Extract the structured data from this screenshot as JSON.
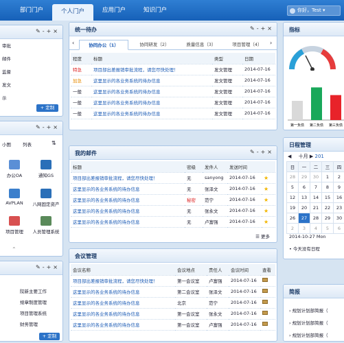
{
  "nav": {
    "tabs": [
      "部门门户",
      "个人门户",
      "应用门户",
      "知识门户"
    ],
    "active": 1,
    "greeting": "你好，Test"
  },
  "left_top": {
    "items": [
      "审批",
      "邮件",
      "监督",
      "发文",
      "示"
    ],
    "custom_button": "+ 定制"
  },
  "left_mid": {
    "tabs": [
      "小图",
      "列表"
    ],
    "apps": [
      "办公OA",
      "通知GS",
      "AVPLAN",
      "八网固定资产",
      "项目管理",
      "人员管理系统"
    ]
  },
  "left_bottom": {
    "items": [
      "院新主要工作",
      "规章制度管理",
      "项目管理系统",
      "财务管理"
    ],
    "custom_button": "+ 定制"
  },
  "todo": {
    "title": "统一待办",
    "tabs": [
      "协同办公（1）",
      "协同研发（2）",
      "质量信息（3）",
      "项目管理（4）"
    ],
    "headers": [
      "程度",
      "标题",
      "类型",
      "日期"
    ],
    "rows": [
      {
        "level": "特急",
        "title": "项目部出差报销审批流程，请您尽快处理！",
        "type": "发文管理",
        "date": "2014-07-16"
      },
      {
        "level": "加急",
        "title": "这里显示的各业务系统的待办信息",
        "type": "发文管理",
        "date": "2014-07-16"
      },
      {
        "level": "一般",
        "title": "这里显示的各业务系统的待办信息",
        "type": "发文管理",
        "date": "2014-07-16"
      },
      {
        "level": "一般",
        "title": "这里显示的各业务系统的待办信息",
        "type": "发文管理",
        "date": "2014-07-16"
      },
      {
        "level": "一般",
        "title": "这里显示的各业务系统的待办信息",
        "type": "发文管理",
        "date": "2014-07-16"
      }
    ]
  },
  "mail": {
    "title": "我的邮件",
    "headers": [
      "标题",
      "密级",
      "发件人",
      "发送时间"
    ],
    "rows": [
      {
        "title": "项目部出差报销审批流程，请您尽快处理！",
        "secret": "无",
        "sender": "sanyong",
        "date": "2014-07-16"
      },
      {
        "title": "这里显示的各业务系统的待办信息",
        "secret": "无",
        "sender": "张泽文",
        "date": "2014-07-16"
      },
      {
        "title": "这里显示的各业务系统的待办信息",
        "secret": "秘密",
        "sender": "范宁",
        "date": "2014-07-16"
      },
      {
        "title": "这里显示的各业务系统的待办信息",
        "secret": "无",
        "sender": "张永文",
        "date": "2014-07-16"
      },
      {
        "title": "这里显示的各业务系统的待办信息",
        "secret": "无",
        "sender": "卢富强",
        "date": "2014-07-16"
      }
    ],
    "more": "更多"
  },
  "meeting": {
    "title": "会议管理",
    "headers": [
      "会议名称",
      "会议地点",
      "责任人",
      "会议时间",
      "查看"
    ],
    "rows": [
      {
        "name": "项目部出差报销审批流程，请您尽快处理！",
        "place": "第一会议室",
        "owner": "卢富强",
        "date": "2014-07-16"
      },
      {
        "name": "这里显示的各业务系统的待办信息",
        "place": "第二会议室",
        "owner": "张泽文",
        "date": "2014-07-16"
      },
      {
        "name": "这里显示的各业务系统的待办信息",
        "place": "北京",
        "owner": "范宁",
        "date": "2014-07-16"
      },
      {
        "name": "这里显示的各业务系统的待办信息",
        "place": "第一会议室",
        "owner": "张永文",
        "date": "2014-07-16"
      },
      {
        "name": "这里显示的各业务系统的待办信息",
        "place": "第一会议室",
        "owner": "卢富强",
        "date": "2014-07-16"
      }
    ]
  },
  "indicator": {
    "title": "指标",
    "bar_labels": [
      "第一负债",
      "第二负债",
      "第三负债"
    ],
    "colors": [
      "#d9d9d9",
      "#19a85a",
      "#e8232a"
    ]
  },
  "chart_data": {
    "type": "bar",
    "categories": [
      "第一负债",
      "第二负债",
      "第三负债"
    ],
    "values": [
      40,
      68,
      52
    ],
    "ylim": [
      0,
      80
    ]
  },
  "calendar": {
    "title": "日程管理",
    "month": "十月",
    "year": "201",
    "weekdays": [
      "日",
      "一",
      "二",
      "三",
      "四"
    ],
    "rows": [
      [
        "28",
        "29",
        "30",
        "1",
        "2"
      ],
      [
        "5",
        "6",
        "7",
        "8",
        "9"
      ],
      [
        "12",
        "13",
        "14",
        "15",
        "16"
      ],
      [
        "19",
        "20",
        "21",
        "22",
        "23"
      ],
      [
        "26",
        "27",
        "28",
        "29",
        "30"
      ],
      [
        "2",
        "3",
        "4",
        "5",
        "6"
      ]
    ],
    "today_label": "2014-10-27 Mon",
    "note": "• 今天没有日程"
  },
  "brief": {
    "title": "简报",
    "items": [
      "规划计划部简报（",
      "规划计划部简报（",
      "规划计划部简报（"
    ]
  }
}
